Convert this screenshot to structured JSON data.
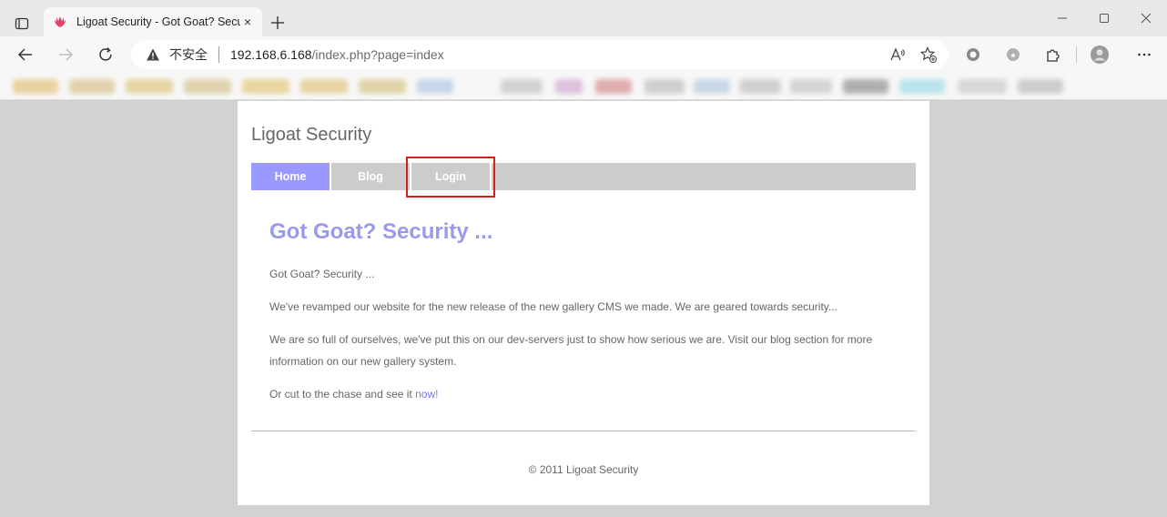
{
  "browser": {
    "tab": {
      "title": "Ligoat Security - Got Goat? Secu",
      "close": "×"
    },
    "address": {
      "security_label": "不安全",
      "url_host": "192.168.6.168",
      "url_path": "/index.php?page=index"
    }
  },
  "site": {
    "name": "Ligoat Security",
    "menu": [
      {
        "label": "Home",
        "active": true
      },
      {
        "label": "Blog",
        "active": false
      },
      {
        "label": "Login",
        "active": false
      }
    ],
    "heading": "Got Goat? Security ...",
    "paragraphs": [
      "Got Goat? Security ...",
      "We've revamped our website for the new release of the new gallery CMS we made. We are geared towards security...",
      "We are so full of ourselves, we've put this on our dev-servers just to show how serious we are. Visit our blog section for more information on our new gallery system."
    ],
    "last_paragraph_prefix": "Or cut to the chase and see it ",
    "last_paragraph_link": "now!",
    "footer": "© 2011 Ligoat Security"
  },
  "colors": {
    "menu_active": "#9999ff",
    "menu_bg": "#cccccc",
    "heading": "#9999ee",
    "highlight": "#d62020"
  }
}
